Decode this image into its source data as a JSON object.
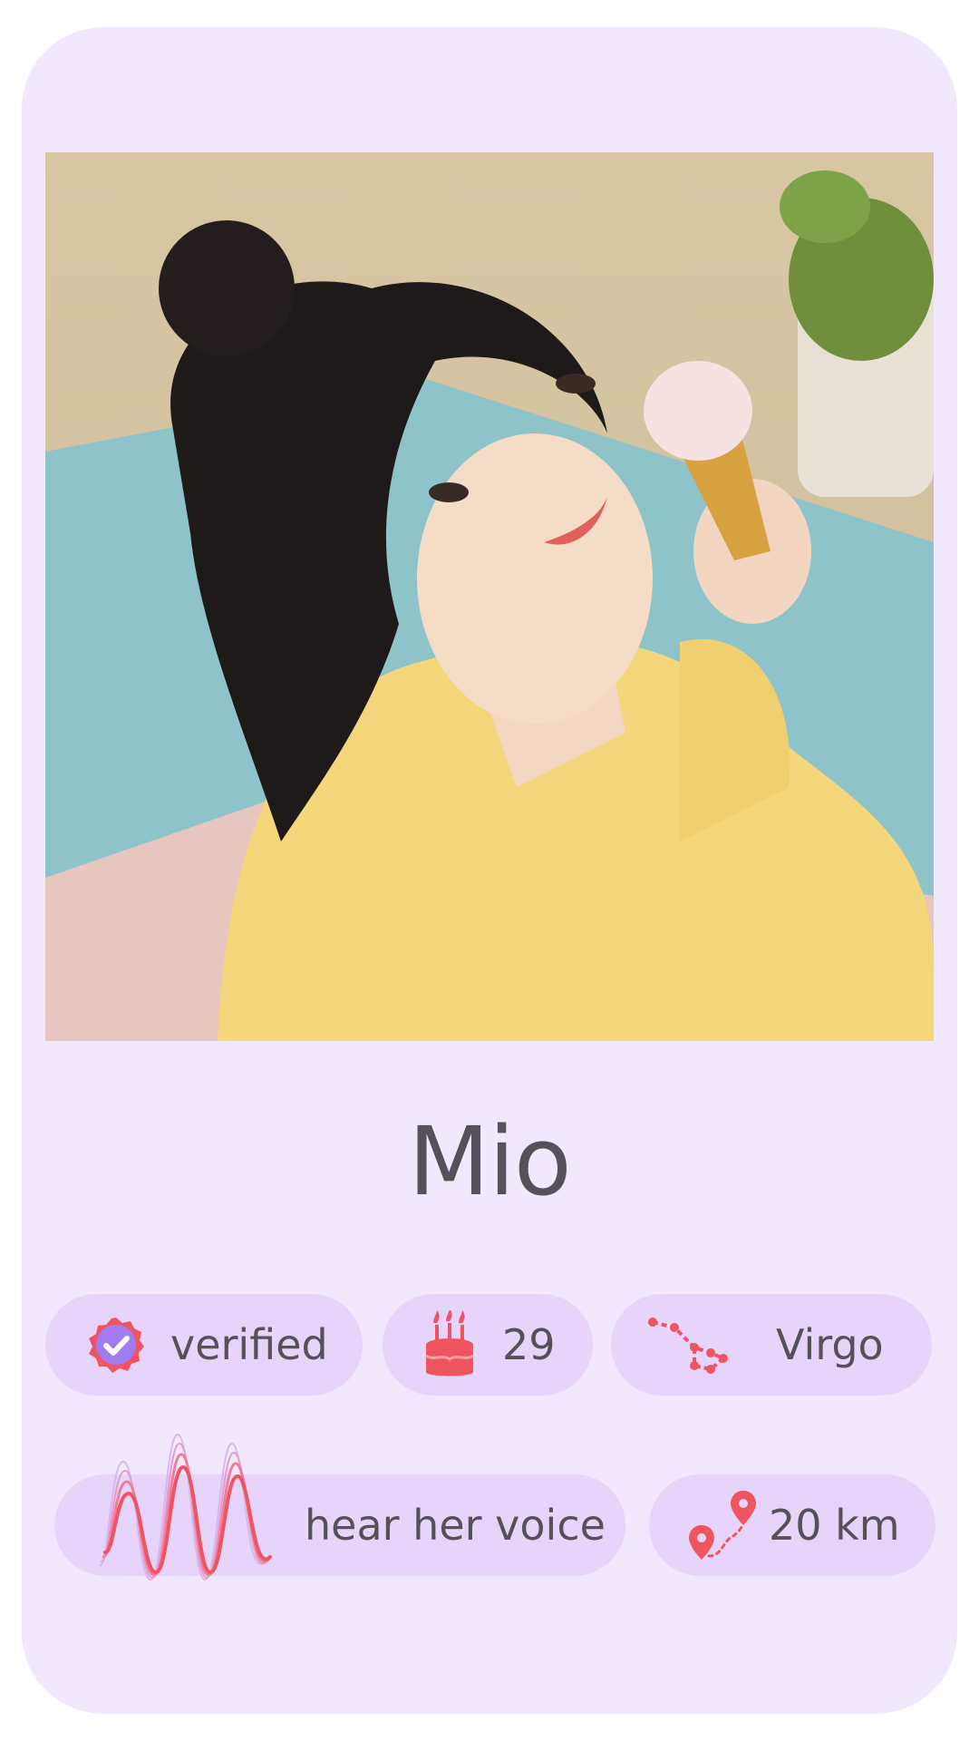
{
  "profile": {
    "name": "Mio",
    "photo_alt": "profile photo of a woman in a yellow cardigan holding an ice cream cone"
  },
  "tags": {
    "verified": "verified",
    "age": "29",
    "zodiac": "Virgo",
    "voice": "hear her voice",
    "distance": "20 km"
  },
  "icons": {
    "verified": "verified-badge-icon",
    "age": "birthday-cake-icon",
    "zodiac": "virgo-constellation-icon",
    "voice": "sound-wave-icon",
    "distance": "route-pins-icon"
  },
  "colors": {
    "card_background": "#f1e8fd",
    "pill_background": "#e7d4fb",
    "text": "#545258",
    "accent_red": "#ef5560",
    "accent_purple": "#a07cf0"
  }
}
